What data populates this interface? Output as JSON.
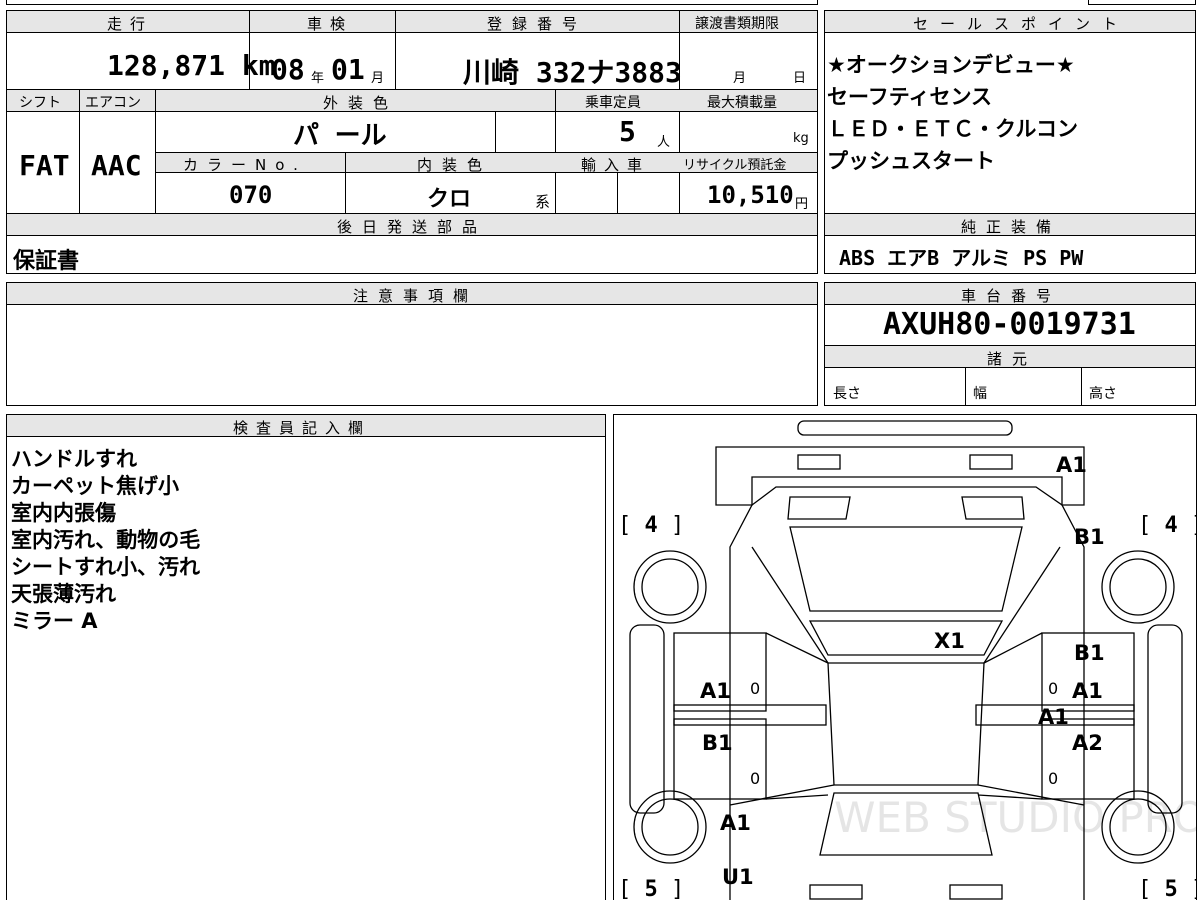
{
  "top_summary": {
    "mileage_label": "走行",
    "mileage_value": "128,871 km",
    "shaken_label": "車検",
    "shaken_year": "08",
    "shaken_year_unit": "年",
    "shaken_month": "01",
    "shaken_month_unit": "月",
    "reg_label": "登録番号",
    "reg_value": "川崎 332ナ3883",
    "doc_deadline_label": "譲渡書類期限",
    "doc_month_unit": "月",
    "doc_day_unit": "日"
  },
  "specs": {
    "shift_label": "シフト",
    "shift_value": "FAT",
    "aircon_label": "エアコン",
    "aircon_value": "AAC",
    "exterior_color_label": "外装色",
    "exterior_color_value": "パ ール",
    "capacity_label": "乗車定員",
    "capacity_value": "5",
    "capacity_unit": "人",
    "max_load_label": "最大積載量",
    "max_load_unit": "kg",
    "color_no_label": "カラーNo.",
    "color_no_value": "070",
    "interior_color_label": "内装色",
    "interior_color_value": "クロ",
    "interior_suffix": "系",
    "import_label": "輸入車",
    "recycle_label": "リサイクル預託金",
    "recycle_value": "10,510",
    "recycle_unit": "円"
  },
  "later_parts": {
    "header": "後日発送部品",
    "value": "保証書"
  },
  "sales_points": {
    "header": "セールスポイント",
    "lines": [
      "★オークションデビュー★",
      "セーフティセンス",
      "ＬＥＤ・ＥＴＣ・クルコン",
      "プッシュスタート"
    ]
  },
  "genuine_equipment": {
    "header": "純正装備",
    "value": "ABS エアB アルミ PS PW"
  },
  "notes": {
    "header": "注意事項欄"
  },
  "chassis": {
    "header": "車台番号",
    "value": "AXUH80-0019731",
    "dims_header": "諸元",
    "length_label": "長さ",
    "width_label": "幅",
    "height_label": "高さ"
  },
  "inspector": {
    "header": "検査員記入欄",
    "lines": [
      "ハンドルすれ",
      "カーペット焦げ小",
      "室内内張傷",
      "室内汚れ、動物の毛",
      "シートすれ小、汚れ",
      "天張薄汚れ",
      "ミラー A"
    ]
  },
  "diagram": {
    "watermark": "WEB STUDIO PRO",
    "tire_front_left": "4",
    "tire_front_right": "4",
    "tire_rear_left": "5",
    "tire_rear_right": "5",
    "marks": {
      "front_bumper": "A1",
      "front_right_fender": "B1",
      "hood": "X1",
      "front_left_door": "A1",
      "rear_left_door": "B1",
      "rear_left_fender": "A1",
      "rear_left_quarter": "U1",
      "front_right_door_top": "B1",
      "front_right_door": "A1",
      "right_pillar": "A1",
      "rear_right_door": "A2"
    }
  }
}
